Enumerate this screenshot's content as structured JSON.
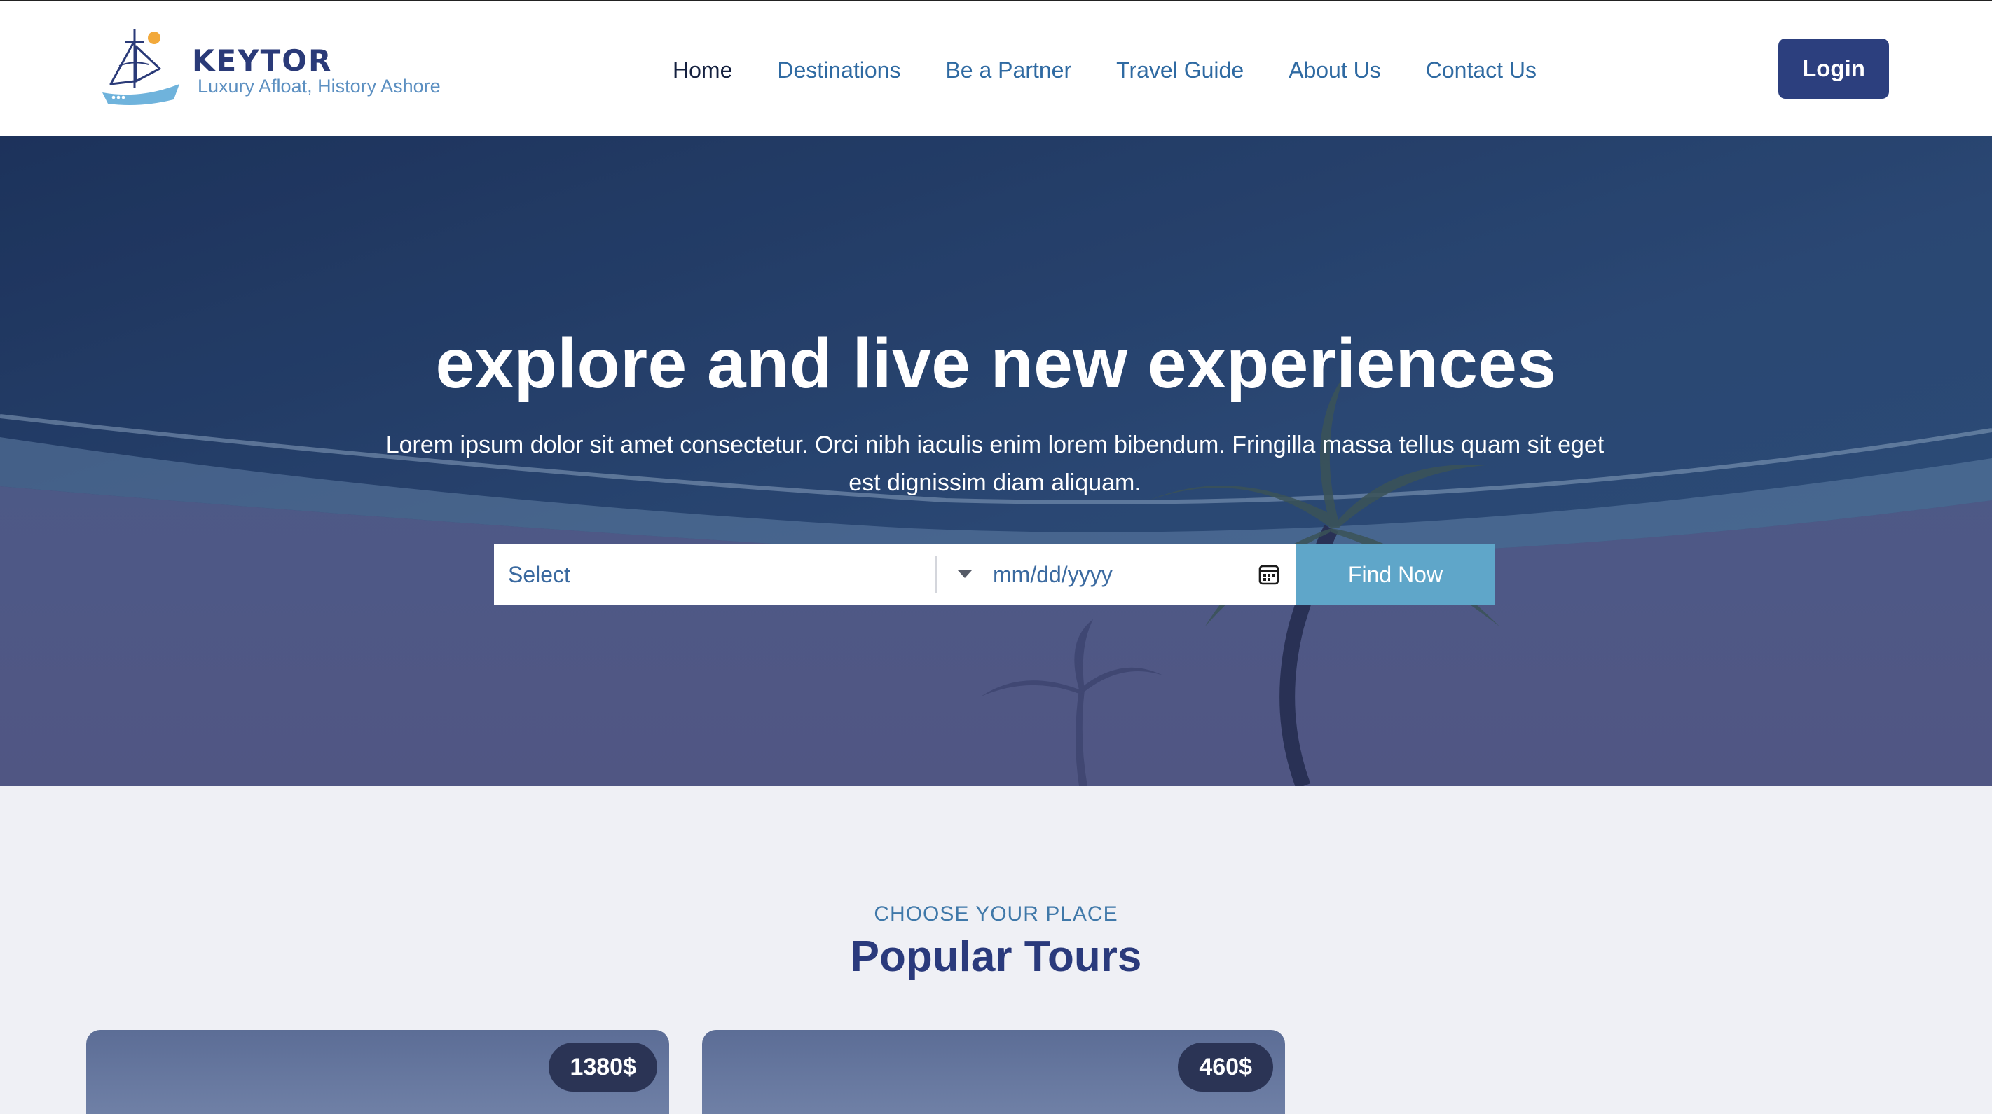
{
  "brand": {
    "name": "KEYTOR",
    "tagline": "Luxury Afloat, History Ashore"
  },
  "nav": {
    "items": [
      {
        "label": "Home",
        "active": true
      },
      {
        "label": "Destinations",
        "active": false
      },
      {
        "label": "Be a Partner",
        "active": false
      },
      {
        "label": "Travel Guide",
        "active": false
      },
      {
        "label": "About Us",
        "active": false
      },
      {
        "label": "Contact Us",
        "active": false
      }
    ],
    "login_label": "Login"
  },
  "hero": {
    "title": "explore and live new experiences",
    "subtitle": "Lorem ipsum dolor sit amet consectetur. Orci nibh iaculis enim lorem bibendum. Fringilla massa tellus quam sit eget est dignissim diam aliquam.",
    "search": {
      "select_value": "Select",
      "date_placeholder": "mm/dd/yyyy",
      "button_label": "Find Now"
    }
  },
  "tours": {
    "kicker": "CHOOSE YOUR PLACE",
    "title": "Popular Tours",
    "cards": [
      {
        "price": "1380$"
      },
      {
        "price": "460$"
      }
    ]
  },
  "colors": {
    "primary": "#2c3f7e",
    "accent": "#5fa6c9",
    "nav_link": "#2f6aa2",
    "section_bg": "#eff0f5"
  },
  "icons": {
    "logo": "sailboat-icon",
    "dropdown": "caret-down-icon",
    "calendar": "calendar-icon"
  }
}
